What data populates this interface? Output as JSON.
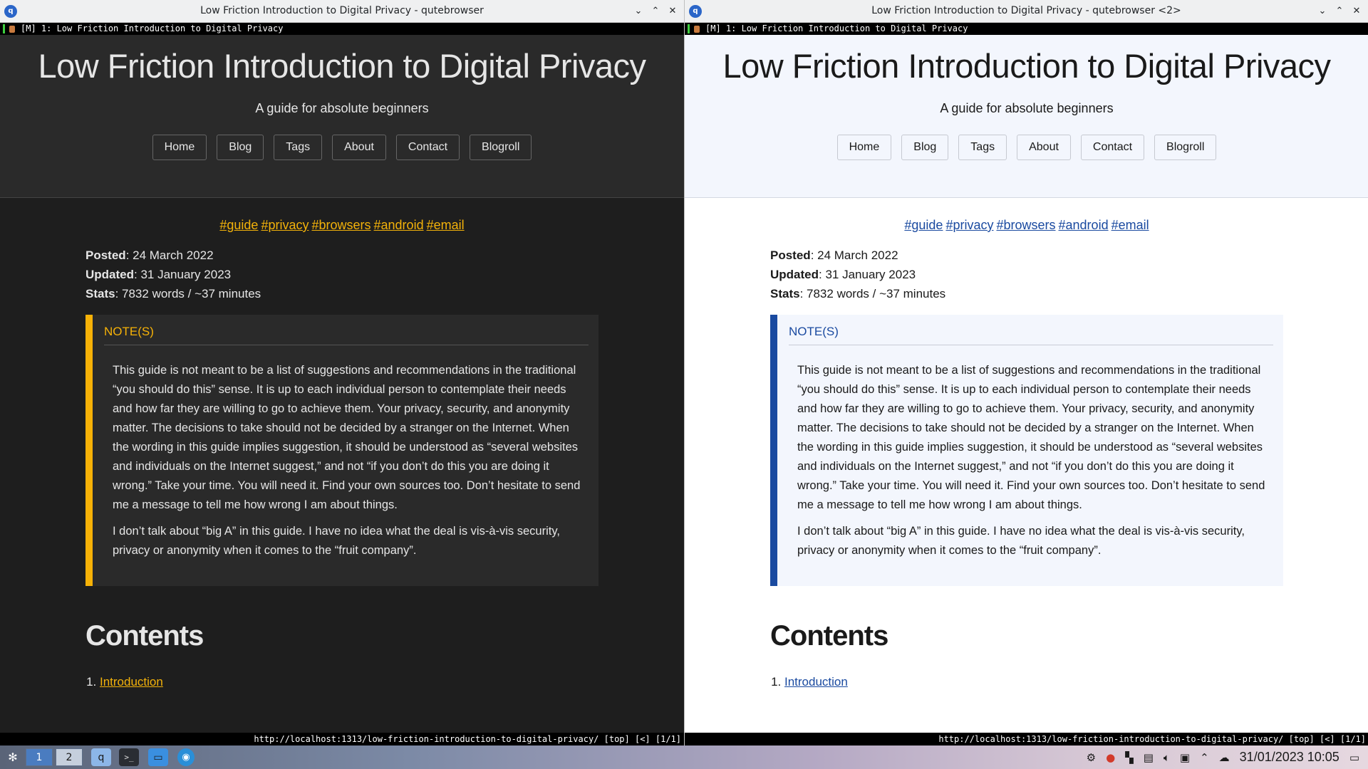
{
  "windows": [
    {
      "title": "Low Friction Introduction to Digital Privacy - qutebrowser",
      "tab_label": "[M] 1: Low Friction Introduction to Digital Privacy",
      "status_url": "http://localhost:1313/low-friction-introduction-to-digital-privacy/ [top] [<] [1/1]",
      "theme": "dark"
    },
    {
      "title": "Low Friction Introduction to Digital Privacy - qutebrowser <2>",
      "tab_label": "[M] 1: Low Friction Introduction to Digital Privacy",
      "status_url": "http://localhost:1313/low-friction-introduction-to-digital-privacy/ [top] [<] [1/1]",
      "theme": "light"
    }
  ],
  "window_controls": {
    "minimize": "⌄",
    "maximize": "⌃",
    "close": "✕"
  },
  "page": {
    "site_title": "Low Friction Introduction to Digital Privacy",
    "subtitle": "A guide for absolute beginners",
    "nav": [
      "Home",
      "Blog",
      "Tags",
      "About",
      "Contact",
      "Blogroll"
    ],
    "tags": [
      "#guide",
      "#privacy",
      "#browsers",
      "#android",
      "#email"
    ],
    "meta": {
      "posted_label": "Posted",
      "posted_value": ": 24 March 2022",
      "updated_label": "Updated",
      "updated_value": ": 31 January 2023",
      "stats_label": "Stats",
      "stats_value": ": 7832 words / ~37 minutes"
    },
    "note": {
      "title": "NOTE(S)",
      "paragraphs": [
        "This guide is not meant to be a list of suggestions and recommendations in the traditional “you should do this” sense. It is up to each individual person to contemplate their needs and how far they are willing to go to achieve them. Your privacy, security, and anonymity matter. The decisions to take should not be decided by a stranger on the Internet. When the wording in this guide implies suggestion, it should be understood as “several websites and individuals on the Internet suggest,” and not “if you don’t do this you are doing it wrong.” Take your time. You will need it. Find your own sources too. Don’t hesitate to send me a message to tell me how wrong I am about things.",
        "I don’t talk about “big A” in this guide. I have no idea what the deal is vis-à-vis security, privacy or anonymity when it comes to the “fruit company”."
      ]
    },
    "contents_heading": "Contents",
    "toc": [
      {
        "number": "1.",
        "label": "Introduction"
      }
    ]
  },
  "taskbar": {
    "desktops": [
      "1",
      "2"
    ],
    "clock": "31/01/2023  10:05"
  },
  "colors": {
    "dark_accent": "#f7b207",
    "light_accent": "#1a4aa0"
  }
}
